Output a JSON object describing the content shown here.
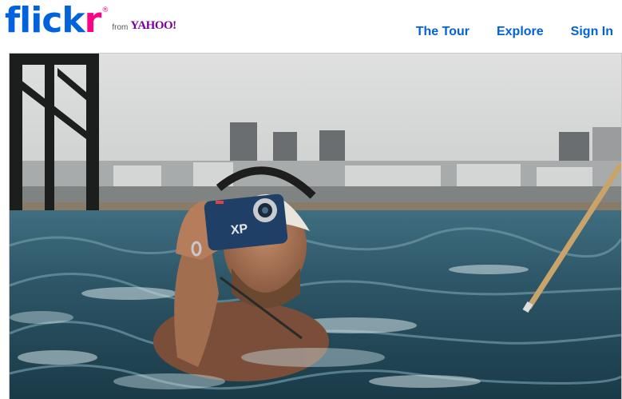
{
  "brand": {
    "word_part1": "flick",
    "word_part2": "r",
    "registered": "®",
    "from": "from",
    "yahoo": "YAHOO!",
    "colors": {
      "blue": "#0063dc",
      "pink": "#ff0084",
      "yahoo_purple": "#7b0099"
    }
  },
  "nav": {
    "items": [
      {
        "label": "The Tour"
      },
      {
        "label": "Explore"
      },
      {
        "label": "Sign In"
      }
    ]
  },
  "hero": {
    "image": "swimmer-with-underwater-camera-photo"
  }
}
